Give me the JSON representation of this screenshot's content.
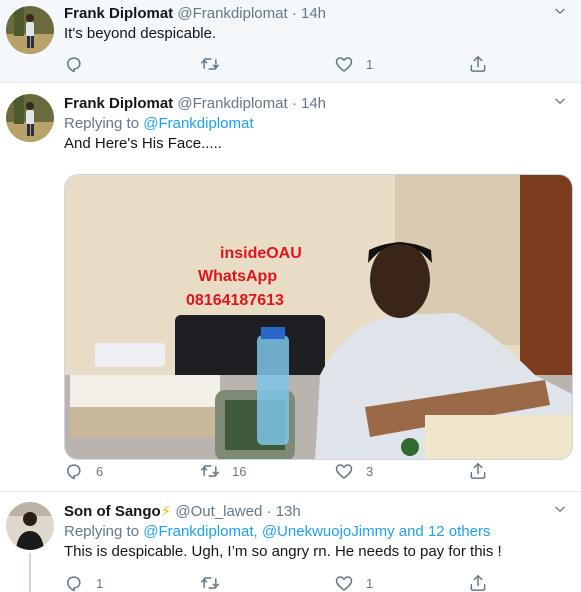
{
  "tweets": [
    {
      "name": "Frank Diplomat",
      "handle": "@Frankdiplomat",
      "separator": "·",
      "time": "14h",
      "text": "It's beyond despicable.",
      "stats": {
        "reply": "",
        "retweet": "",
        "like": "1"
      }
    },
    {
      "name": "Frank Diplomat",
      "handle": "@Frankdiplomat",
      "separator": "·",
      "time": "14h",
      "replying_prefix": "Replying to",
      "replying_to": "@Frankdiplomat",
      "text": "And Here's His Face.....",
      "image_overlay": {
        "line1": "insideOAU",
        "line2": "WhatsApp",
        "line3": "08164187613"
      },
      "stats": {
        "reply": "6",
        "retweet": "16",
        "like": "3"
      }
    },
    {
      "name": "Son of Sango",
      "name_emoji": "⚡",
      "handle": "@Out_lawed",
      "separator": "·",
      "time": "13h",
      "replying_prefix": "Replying to",
      "replying_to": "@Frankdiplomat, @UnekwuojoJimmy and 12 others",
      "text": "This is despicable. Ugh, I’m so angry rn. He needs to pay for this !",
      "stats": {
        "reply": "1",
        "retweet": "",
        "like": "1"
      }
    }
  ],
  "colors": {
    "link": "#1da1f2",
    "muted": "#657786",
    "overlay_text": "#e0151b",
    "emoji": "#f5b800"
  },
  "icons": [
    "reply-icon",
    "retweet-icon",
    "like-icon",
    "share-icon",
    "chevron-down-icon"
  ]
}
